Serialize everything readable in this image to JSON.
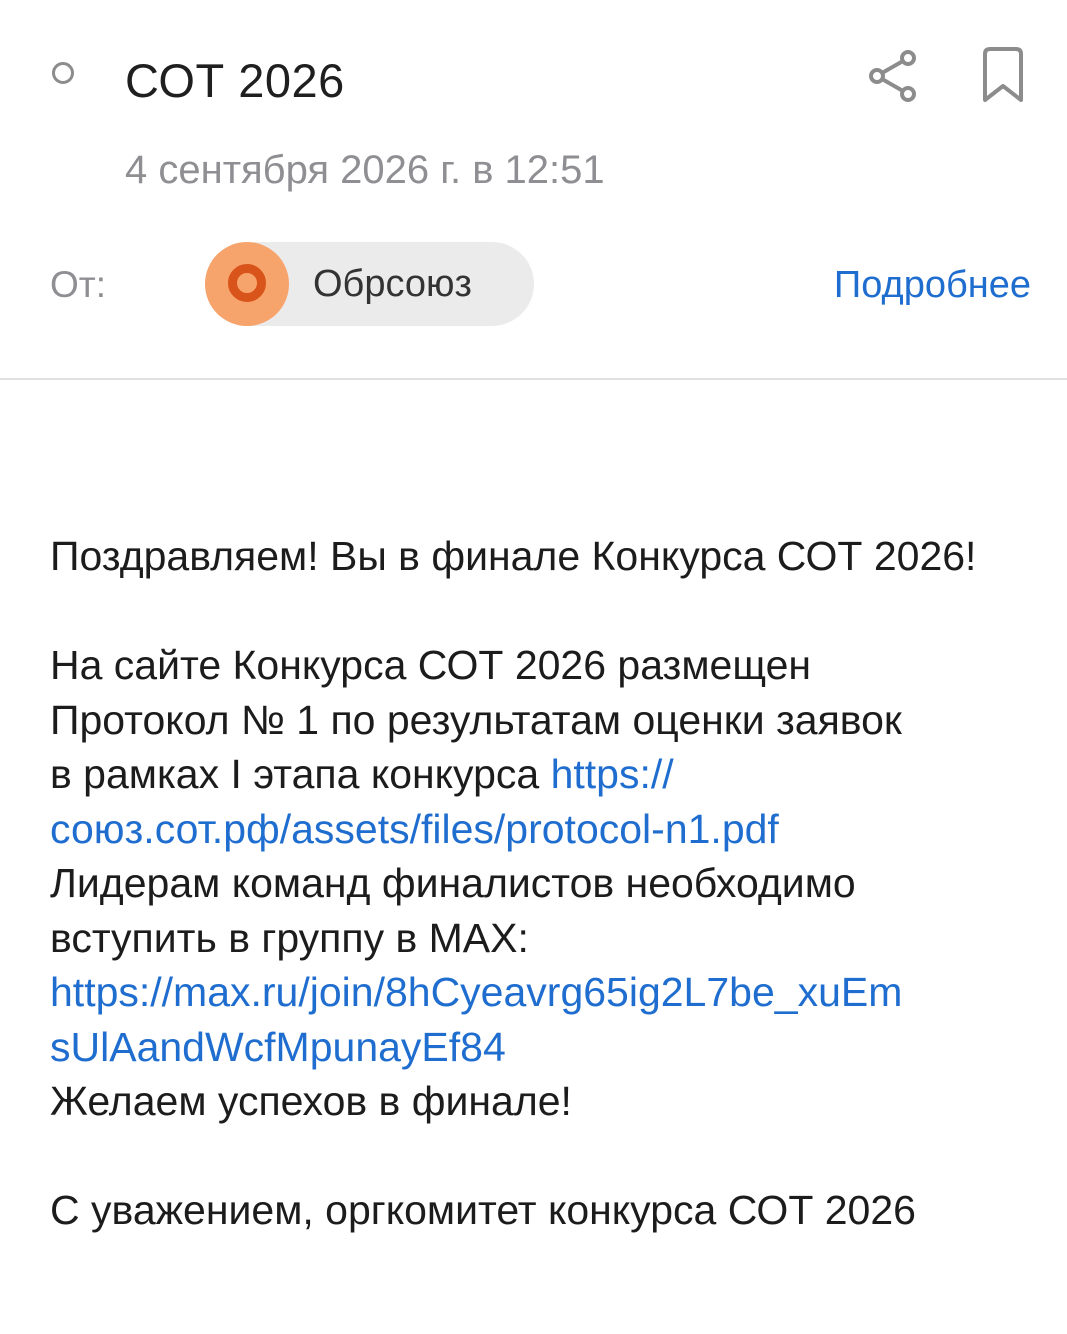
{
  "header": {
    "subject": "СОТ 2026",
    "date": "4 сентября 2026 г. в 12:51"
  },
  "sender": {
    "from_label": "От:",
    "name": "Обрсоюз",
    "details_label": "Подробнее"
  },
  "colors": {
    "link": "#1f6ecf",
    "avatar_bg": "#f7a36c",
    "avatar_ring": "#d8541b"
  },
  "message": {
    "p1": "Поздравляем! Вы в финале Конкурса СОТ 2026!",
    "p2_line1": "На сайте Конкурса СОТ 2026 размещен",
    "p2_line2": "Протокол № 1 по результатам оценки заявок",
    "p2_line3_prefix": "в рамках I этапа конкурса ",
    "link1_part1": "https://",
    "link1_part2": "союз.сот.рф/assets/files/protocol-n1.pdf",
    "p3_line1": "Лидерам команд финалистов необходимо",
    "p3_line2": "вступить в группу в MAX:",
    "link2_part1": "https://max.ru/join/8hCyeavrg65ig2L7be_xuEm",
    "link2_part2": "sUlAandWcfMpunayEf84",
    "p4": "Желаем успехов в финале!",
    "signature": "С уважением, оргкомитет конкурса СОТ 2026"
  }
}
